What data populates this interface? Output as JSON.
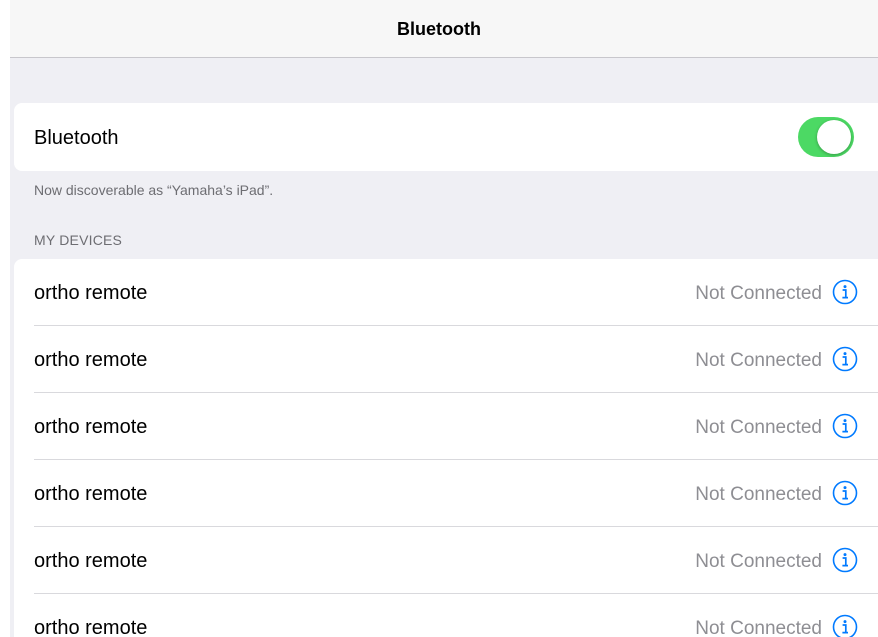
{
  "navbar": {
    "title": "Bluetooth"
  },
  "bluetooth": {
    "label": "Bluetooth",
    "enabled": true,
    "toggle_color": "#4cd964"
  },
  "discoverable_text": "Now discoverable as “Yamaha’s iPad”.",
  "my_devices": {
    "header": "MY DEVICES",
    "items": [
      {
        "name": "ortho remote",
        "status": "Not Connected",
        "icon": "info-icon"
      },
      {
        "name": "ortho remote",
        "status": "Not Connected",
        "icon": "info-icon"
      },
      {
        "name": "ortho remote",
        "status": "Not Connected",
        "icon": "info-icon"
      },
      {
        "name": "ortho remote",
        "status": "Not Connected",
        "icon": "info-icon"
      },
      {
        "name": "ortho remote",
        "status": "Not Connected",
        "icon": "info-icon"
      },
      {
        "name": "ortho remote",
        "status": "Not Connected",
        "icon": "info-icon"
      }
    ]
  },
  "colors": {
    "accent": "#007aff",
    "secondary_text": "#8e8e93",
    "group_background": "#efeff4"
  }
}
